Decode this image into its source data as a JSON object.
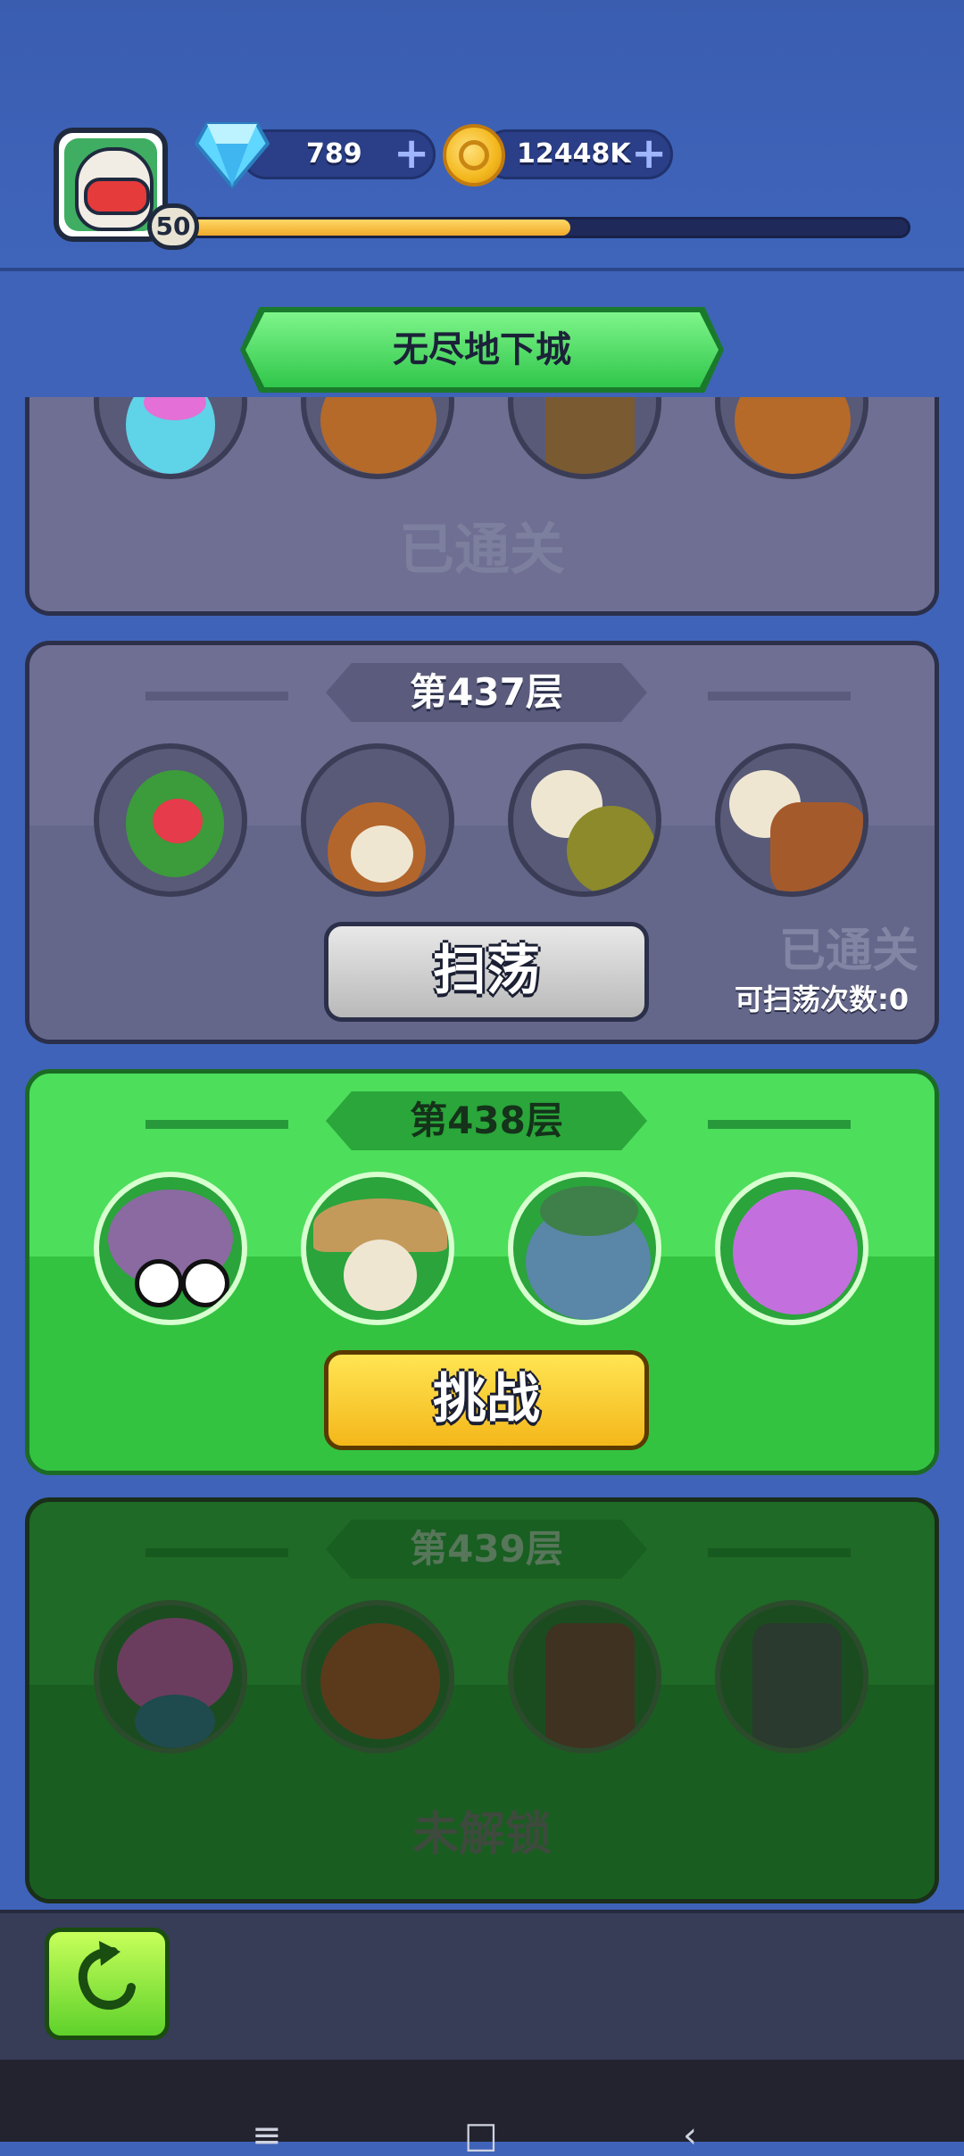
{
  "player": {
    "level": "50",
    "xp_fraction": 0.53
  },
  "currencies": {
    "gems": "789",
    "coins": "12448K",
    "plus": "+"
  },
  "title": "无尽地下城",
  "floors": [
    {
      "status_label": "已通关"
    },
    {
      "name": "第437层",
      "button_label": "扫荡",
      "status_label": "已通关",
      "sweep_count_label": "可扫荡次数:0"
    },
    {
      "name": "第438层",
      "button_label": "挑战"
    },
    {
      "name": "第439层",
      "status_label": "未解锁"
    }
  ],
  "navbar": {
    "menu_icon": "≡",
    "home_icon": "□",
    "back_icon": "‹"
  },
  "colors": {
    "accent_green": "#4dde5c",
    "cleared_grey": "#6f6f93",
    "locked_green": "#1f6a26",
    "button_yellow": "#f4b71a"
  },
  "icons": [
    "gem-icon",
    "coin-icon",
    "plus-icon",
    "back-arrow-icon",
    "avatar-icon"
  ]
}
